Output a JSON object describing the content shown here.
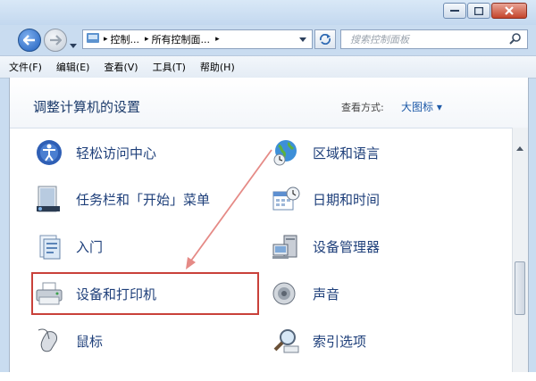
{
  "toolbar": {
    "breadcrumb": [
      "控制...",
      "所有控制面..."
    ],
    "search_placeholder": "搜索控制面板"
  },
  "menu": [
    "文件(F)",
    "编辑(E)",
    "查看(V)",
    "工具(T)",
    "帮助(H)"
  ],
  "header": {
    "title": "调整计算机的设置",
    "view_by_label": "查看方式:",
    "view_by_value": "大图标 ▾"
  },
  "items_left": [
    {
      "label": "轻松访问中心",
      "icon": "ease-of-access-icon"
    },
    {
      "label": "任务栏和「开始」菜单",
      "icon": "taskbar-icon"
    },
    {
      "label": "入门",
      "icon": "getting-started-icon"
    },
    {
      "label": "设备和打印机",
      "icon": "printer-icon"
    },
    {
      "label": "鼠标",
      "icon": "mouse-icon"
    }
  ],
  "items_right": [
    {
      "label": "区域和语言",
      "icon": "globe-icon"
    },
    {
      "label": "日期和时间",
      "icon": "calendar-clock-icon"
    },
    {
      "label": "设备管理器",
      "icon": "device-manager-icon"
    },
    {
      "label": "声音",
      "icon": "speaker-icon"
    },
    {
      "label": "索引选项",
      "icon": "index-search-icon"
    }
  ],
  "colors": {
    "highlight_border": "#c9413a",
    "link_text": "#1e3f7a",
    "arrow": "#e58a86"
  }
}
